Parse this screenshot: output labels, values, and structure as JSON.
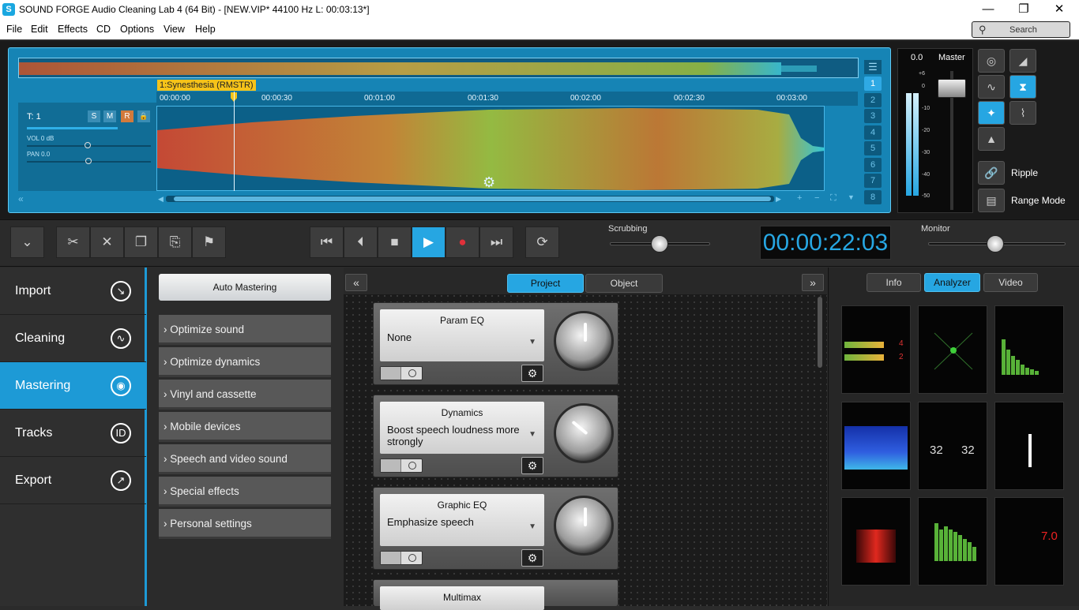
{
  "window": {
    "title": "SOUND FORGE Audio Cleaning Lab 4 (64 Bit) - [NEW.VIP*   44100 Hz L: 00:03:13*]",
    "app_icon": "S",
    "minimize": "—",
    "maximize": "❐",
    "close": "✕"
  },
  "menu": [
    "File",
    "Edit",
    "Effects",
    "CD",
    "Options",
    "View",
    "Help"
  ],
  "search": {
    "label": "Search",
    "icon": "search-icon"
  },
  "track": {
    "label": "1:Synesthesia (RMSTR)",
    "name": "T:  1",
    "buttons": [
      "S",
      "M",
      "R"
    ],
    "vol": "VOL  0 dB",
    "pan": "PAN    0.0"
  },
  "ruler": [
    "00:00:00",
    "00:00:30",
    "00:01:00",
    "00:01:30",
    "00:02:00",
    "00:02:30",
    "00:03:00"
  ],
  "track_numbers": [
    "1",
    "2",
    "3",
    "4",
    "5",
    "6",
    "7",
    "8"
  ],
  "master": {
    "value": "0.0",
    "label": "Master",
    "scale": [
      "+6",
      "0",
      "-10",
      "-20",
      "-30",
      "-40",
      "-50"
    ]
  },
  "tools": {
    "ripple": "Ripple",
    "range_mode": "Range Mode"
  },
  "transport": {
    "scrubbing_label": "Scrubbing",
    "monitor_label": "Monitor",
    "time": "00:00:22:03"
  },
  "nav": [
    {
      "label": "Import",
      "icon": "import-icon"
    },
    {
      "label": "Cleaning",
      "icon": "cleaning-icon"
    },
    {
      "label": "Mastering",
      "icon": "mastering-icon"
    },
    {
      "label": "Tracks",
      "icon": "tracks-icon"
    },
    {
      "label": "Export",
      "icon": "export-icon"
    }
  ],
  "presets": {
    "auto": "Auto Mastering",
    "items": [
      "Optimize sound",
      "Optimize dynamics",
      "Vinyl and cassette",
      "Mobile devices",
      "Speech and video sound",
      "Special effects",
      "Personal settings"
    ]
  },
  "fx_tabs": [
    "Project",
    "Object"
  ],
  "effects": [
    {
      "name": "Param EQ",
      "value": "None"
    },
    {
      "name": "Dynamics",
      "value": "Boost speech loudness more strongly"
    },
    {
      "name": "Graphic EQ",
      "value": "Emphasize speech"
    },
    {
      "name": "Multimax",
      "value": ""
    }
  ],
  "right_tabs": [
    "Info",
    "Analyzer",
    "Video"
  ],
  "analyzer": {
    "meter_a": "4",
    "meter_b": "2",
    "left_val": "32",
    "right_val": "32",
    "loudness": "7.0"
  },
  "colors": {
    "accent": "#26a6e2",
    "wave_bg": "#1684b5",
    "record": "#e0303a",
    "label_yellow": "#f5c31a"
  }
}
